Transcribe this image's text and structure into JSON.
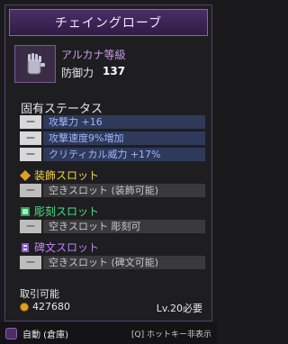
{
  "item": {
    "name": "チェイングローブ",
    "grade": "アルカナ等級",
    "defense_label": "防御力",
    "defense_value": "137"
  },
  "fixed_status": {
    "title": "固有ステータス",
    "rows": [
      {
        "dash": "ー",
        "text": "攻撃力 +16"
      },
      {
        "dash": "ー",
        "text": "攻撃速度9%増加"
      },
      {
        "dash": "ー",
        "text": "クリティカル威力 +17%"
      }
    ]
  },
  "slots": {
    "ornament": {
      "title": "装飾スロット",
      "row": {
        "dash": "ー",
        "text": "空きスロット (装飾可能)"
      },
      "color": "#f3d24a"
    },
    "engrave": {
      "title": "彫刻スロット",
      "row": {
        "dash": "ー",
        "text": "空きスロット 彫刻可"
      },
      "color": "#4ade80"
    },
    "rune": {
      "title": "碑文スロット",
      "row": {
        "dash": "ー",
        "text": "空きスロット (碑文可能)"
      },
      "color": "#c084fc"
    }
  },
  "trade": {
    "label": "取引可能",
    "price": "427680",
    "level_requirement": "Lv.20必要"
  },
  "footer": {
    "auto_label": "自動 (倉庫)",
    "hotkey_hint": "[Q] ホットキー非表示"
  },
  "colors": {
    "accent": "#8c5fb8",
    "stat_text": "#9fb6ff",
    "slot_title": "#f3d24a"
  }
}
